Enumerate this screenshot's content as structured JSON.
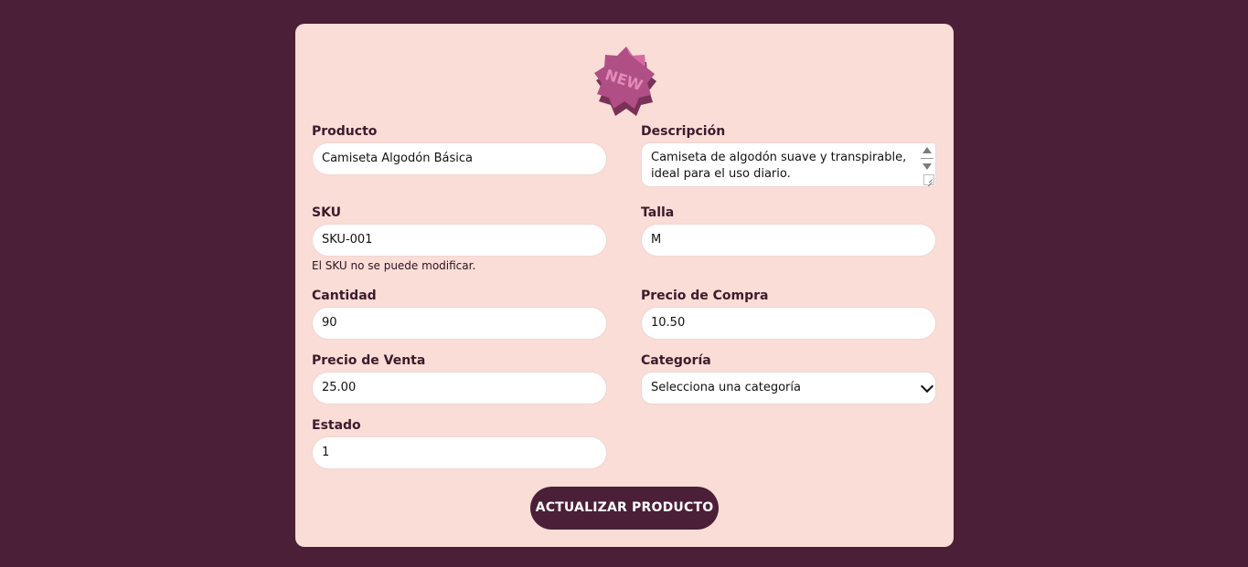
{
  "form": {
    "badge_text": "NEW",
    "fields": {
      "producto": {
        "label": "Producto",
        "value": "Camiseta Algodón Básica"
      },
      "descripcion": {
        "label": "Descripción",
        "value": "Camiseta de algodón suave y transpirable, ideal para el uso diario."
      },
      "sku": {
        "label": "SKU",
        "value": "SKU-001",
        "hint": "El SKU no se puede modificar."
      },
      "talla": {
        "label": "Talla",
        "value": "M"
      },
      "cantidad": {
        "label": "Cantidad",
        "value": "90"
      },
      "precio_compra": {
        "label": "Precio de Compra",
        "value": "10.50"
      },
      "precio_venta": {
        "label": "Precio de Venta",
        "value": "25.00"
      },
      "categoria": {
        "label": "Categoría",
        "selected": "Selecciona una categoría"
      },
      "estado": {
        "label": "Estado",
        "value": "1"
      }
    },
    "submit_label": "ACTUALIZAR PRODUCTO"
  },
  "colors": {
    "background": "#4b1f37",
    "card": "#f9ddd6",
    "button": "#4b1f37",
    "badge": "#b04f86"
  }
}
